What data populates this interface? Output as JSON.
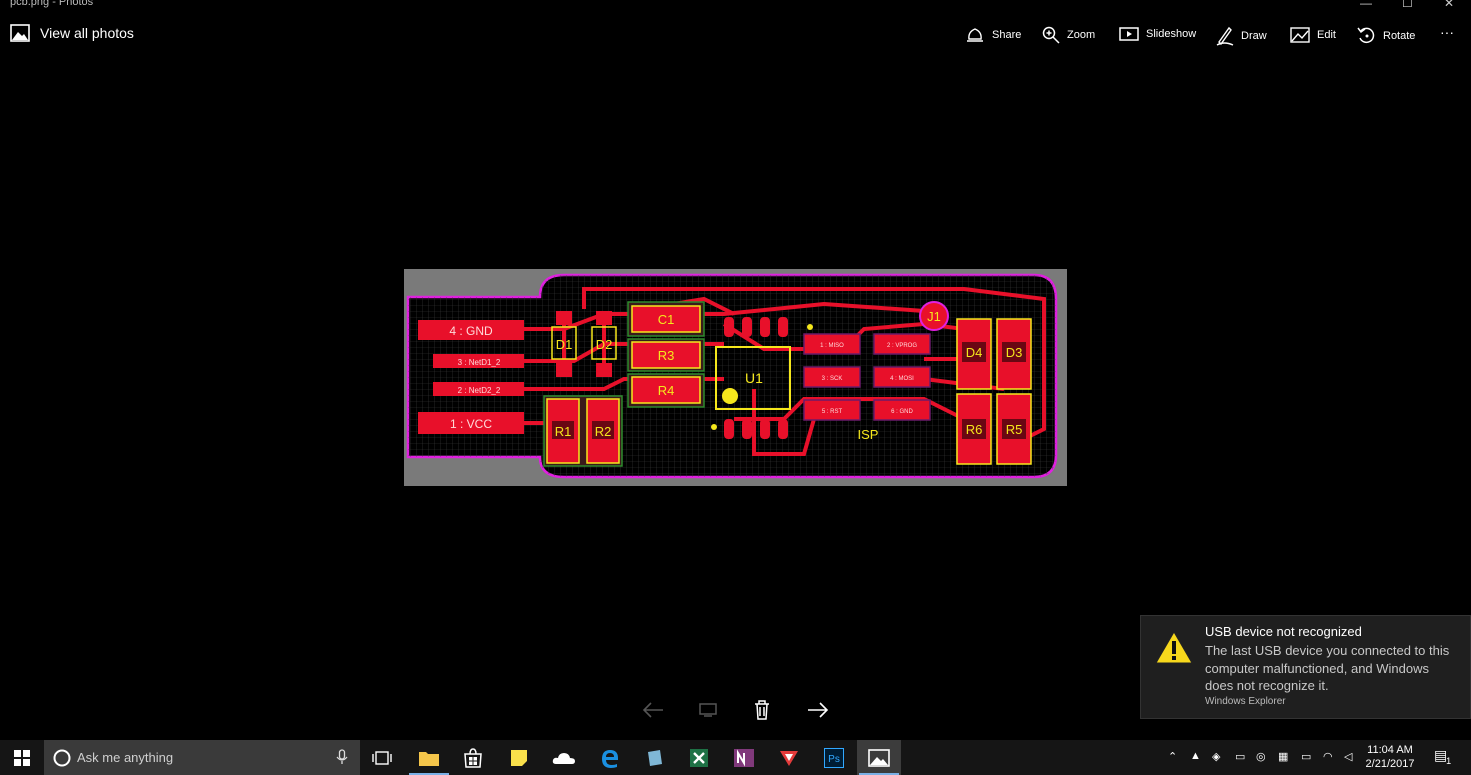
{
  "window": {
    "title": "pcb.png - Photos"
  },
  "appbar": {
    "view_all": "View all photos",
    "commands": [
      {
        "label": "Share",
        "icon": "share-icon"
      },
      {
        "label": "Zoom",
        "icon": "zoom-icon"
      },
      {
        "label": "Slideshow",
        "icon": "slideshow-icon"
      },
      {
        "label": "Draw",
        "icon": "draw-icon"
      },
      {
        "label": "Edit",
        "icon": "edit-icon"
      },
      {
        "label": "Rotate",
        "icon": "rotate-icon"
      }
    ],
    "more": "···"
  },
  "pcb": {
    "connectors": [
      "4 : GND",
      "3 : NetD1_2",
      "2 : NetD2_2",
      "1 : VCC"
    ],
    "components": [
      "D1",
      "D2",
      "C1",
      "R3",
      "R4",
      "U1",
      "R1",
      "R2",
      "J1",
      "D4",
      "D3",
      "R6",
      "R5",
      "ISP"
    ],
    "isp_pads": [
      "1 : MISO",
      "2 : VPROG",
      "3 : SCK",
      "4 : MOSI",
      "5 : RST",
      "6 : GND"
    ],
    "colors": {
      "board": "#000000",
      "copper": "#e8102a",
      "silk": "#f5e71c",
      "outline": "#e020e0",
      "grid": "#3a3a3a"
    }
  },
  "notification": {
    "title": "USB device not recognized",
    "body": "The last USB device you connected to this computer malfunctioned, and Windows does not recognize it.",
    "source": "Windows Explorer"
  },
  "taskbar": {
    "search_placeholder": "Ask me anything",
    "time": "11:04 AM",
    "date": "2/21/2017",
    "notification_count": "1"
  }
}
